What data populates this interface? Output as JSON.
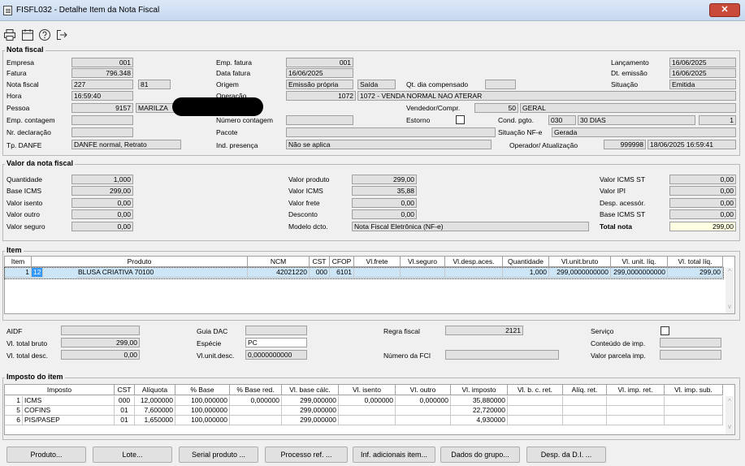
{
  "window": {
    "title": "FISFL032 - Detalhe Item da Nota Fiscal",
    "close": "✕"
  },
  "toolbar": [
    {
      "icon": "print-icon"
    },
    {
      "icon": "calendar-icon"
    },
    {
      "icon": "help-icon"
    },
    {
      "icon": "exit-icon"
    }
  ],
  "nota": {
    "title": "Nota fiscal",
    "empresa_l": "Empresa",
    "empresa": "001",
    "fatura_l": "Fatura",
    "fatura": "796.348",
    "nota_l": "Nota fiscal",
    "nota": "227",
    "serie": "81",
    "hora_l": "Hora",
    "hora": "16:59:40",
    "pessoa_l": "Pessoa",
    "pessoa_cod": "9157",
    "pessoa_nome": "MARILZA",
    "emp_contagem_l": "Emp. contagem",
    "nr_decl_l": "Nr. declaração",
    "tp_danfe_l": "Tp. DANFE",
    "tp_danfe": "DANFE normal, Retrato",
    "emp_fatura_l": "Emp. fatura",
    "emp_fatura": "001",
    "data_fatura_l": "Data fatura",
    "data_fatura": "16/06/2025",
    "origem_l": "Origem",
    "origem": "Emissão própria",
    "origem2": "Saída",
    "qt_dia_l": "Qt. dia compensado",
    "operacao_l": "Operação",
    "operacao_cod": "1072",
    "operacao": "1072 - VENDA NORMAL NAO ATERAR",
    "vendedor_l": "Vendedor/Compr.",
    "vendedor_cod": "50",
    "vendedor": "GERAL",
    "num_contagem_l": "Número contagem",
    "estorno_l": "Estorno",
    "cond_pgto_l": "Cond. pgto.",
    "cond_cod": "030",
    "cond": "30 DIAS",
    "cond_n": "1",
    "pacote_l": "Pacote",
    "situacao_nfe_l": "Situação NF-e",
    "situacao_nfe": "Gerada",
    "ind_presenca_l": "Ind. presença",
    "ind_presenca": "Não se aplica",
    "operador_l": "Operador/ Atualização",
    "operador": "999998",
    "operador_data": "18/06/2025 16:59:41",
    "lancamento_l": "Lançamento",
    "lancamento": "16/06/2025",
    "dt_emissao_l": "Dt. emissão",
    "dt_emissao": "16/06/2025",
    "situacao_l": "Situação",
    "situacao": "Emitida"
  },
  "valor": {
    "title": "Valor da nota fiscal",
    "quantidade_l": "Quantidade",
    "quantidade": "1,000",
    "base_icms_l": "Base ICMS",
    "base_icms": "299,00",
    "valor_isento_l": "Valor isento",
    "valor_isento": "0,00",
    "valor_outro_l": "Valor outro",
    "valor_outro": "0,00",
    "valor_seguro_l": "Valor seguro",
    "valor_seguro": "0,00",
    "valor_produto_l": "Valor produto",
    "valor_produto": "299,00",
    "valor_icms_l": "Valor ICMS",
    "valor_icms": "35,88",
    "valor_frete_l": "Valor frete",
    "valor_frete": "0,00",
    "desconto_l": "Desconto",
    "desconto": "0,00",
    "modelo_l": "Modelo dcto.",
    "modelo": "Nota Fiscal Eletrônica (NF-e)",
    "icms_st_l": "Valor ICMS ST",
    "icms_st": "0,00",
    "ipi_l": "Valor IPI",
    "ipi": "0,00",
    "desp_l": "Desp. acessór.",
    "desp": "0,00",
    "base_st_l": "Base ICMS ST",
    "base_st": "0,00",
    "total_l": "Total nota",
    "total": "299,00"
  },
  "item": {
    "title": "Item",
    "headers": [
      "Item",
      "Produto",
      "NCM",
      "CST",
      "CFOP",
      "Vl.frete",
      "Vl.seguro",
      "Vl.desp.aces.",
      "Quantidade",
      "Vl.unit.bruto",
      "Vl. unit. líq.",
      "Vl. total líq."
    ],
    "rows": [
      [
        "1",
        "12",
        "BLUSA CRIATIVA 70100",
        "42021220",
        "000",
        "6101",
        "",
        "",
        "",
        "1,000",
        "299,0000000000",
        "299,0000000000",
        "299,00"
      ]
    ]
  },
  "mid": {
    "aidf_l": "AIDF",
    "vl_bruto_l": "Vl. total bruto",
    "vl_bruto": "299,00",
    "vl_desc_l": "Vl. total desc.",
    "vl_desc": "0,00",
    "guia_l": "Guia DAC",
    "especie_l": "Espécie",
    "especie": "PC",
    "vlunit_l": "Vl.unit.desc.",
    "vlunit": "0,0000000000",
    "regra_l": "Regra fiscal",
    "regra": "2121",
    "fci_l": "Número da FCI",
    "servico_l": "Serviço",
    "conteudo_l": "Conteúdo de imp.",
    "parcela_l": "Valor parcela imp."
  },
  "imposto": {
    "title": "Imposto do item",
    "headers": [
      "Imposto",
      "CST",
      "Alíquota",
      "% Base",
      "% Base red.",
      "Vl. base cálc.",
      "Vl. isento",
      "Vl. outro",
      "Vl. imposto",
      "Vl. b. c. ret.",
      "Alíq. ret.",
      "Vl. imp. ret.",
      "Vl. imp. sub."
    ],
    "rows": [
      [
        "1",
        "ICMS",
        "000",
        "12,000000",
        "100,000000",
        "0,000000",
        "299,000000",
        "0,000000",
        "0,000000",
        "35,880000",
        "",
        "",
        "",
        ""
      ],
      [
        "5",
        "COFINS",
        "01",
        "7,600000",
        "100,000000",
        "",
        "299,000000",
        "",
        "",
        "22,720000",
        "",
        "",
        "",
        ""
      ],
      [
        "6",
        "PIS/PASEP",
        "01",
        "1,650000",
        "100,000000",
        "",
        "299,000000",
        "",
        "",
        "4,930000",
        "",
        "",
        "",
        ""
      ]
    ]
  },
  "buttons": [
    "Produto...",
    "Lote...",
    "Serial produto ...",
    "Processo ref. ...",
    "Inf. adicionais item...",
    "Dados do grupo...",
    "Desp. da D.I. ..."
  ]
}
